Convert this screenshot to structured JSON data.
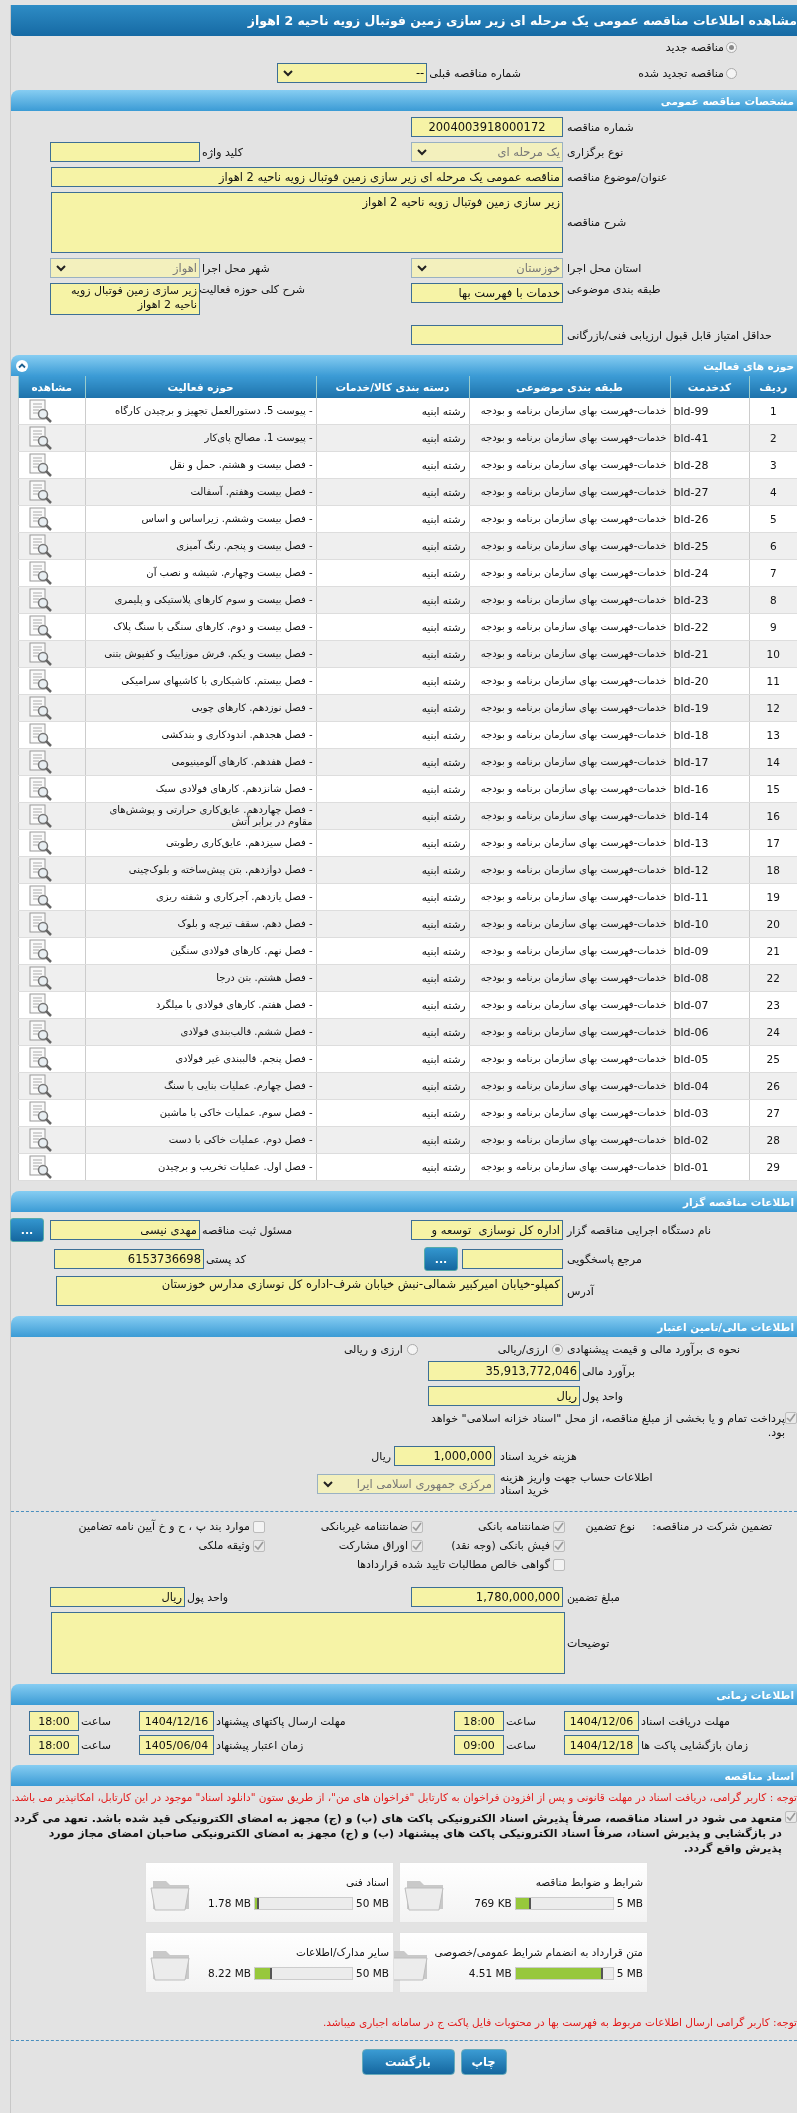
{
  "title": "مشاهده اطلاعات مناقصه عمومی یک مرحله ای زیر سازی زمین فوتبال زویه ناحیه 2 اهواز",
  "tender_kind": [
    {
      "label": "مناقصه جدید",
      "selected": true
    },
    {
      "label": "مناقصه تجدید شده",
      "selected": false
    }
  ],
  "previous_tender": {
    "label": "شماره مناقصه قبلی",
    "value": "--"
  },
  "general": {
    "header": "مشخصات مناقصه عمومی",
    "tender_number": {
      "label": "شماره مناقصه",
      "value": "2004003918000172"
    },
    "holding_type": {
      "label": "نوع برگزاری",
      "value": "یک مرحله ای",
      "disabled": true
    },
    "keyword": {
      "label": "کلید واژه"
    },
    "subject": {
      "label": "عنوان/موضوع مناقصه",
      "value": "مناقصه عمومی یک مرحله ای زیر سازی زمین فوتبال زویه ناحیه 2 اهواز"
    },
    "description": {
      "label": "شرح مناقصه",
      "value": "زیر سازی زمین فوتبال زویه ناحیه 2 اهواز"
    },
    "province": {
      "label": "استان محل اجرا",
      "value": "خوزستان",
      "disabled": true
    },
    "city": {
      "label": "شهر محل اجرا",
      "value": "اهواز",
      "disabled": true
    },
    "category": {
      "label": "طبقه بندی موضوعی",
      "value": "خدمات با فهرست بها"
    },
    "scope": {
      "label": "شرح کلی حوزه فعالیت",
      "value": "زیر سازی زمین فوتبال زویه ناحیه 2 اهواز"
    },
    "min_score": {
      "label": "حداقل امتیاز قابل قبول ارزیابی فنی/بازرگانی"
    }
  },
  "activities": {
    "header": "حوزه های فعالیت",
    "columns": [
      "ردیف",
      "کدخدمت",
      "طبقه بندی موضوعی",
      "دسته بندی کالا/خدمات",
      "حوزه فعالیت",
      "مشاهده"
    ],
    "rows": [
      {
        "row": "1",
        "code": "bld-99",
        "category": "خدمات-فهرست بهای سازمان برنامه و بودجه",
        "group": "رشته ابنیه",
        "activity": "- پیوست 5. دستورالعمل تجهیز و برچیدن کارگاه"
      },
      {
        "row": "2",
        "code": "bld-41",
        "category": "خدمات-فهرست بهای سازمان برنامه و بودجه",
        "group": "رشته ابنیه",
        "activity": "- پیوست 1. مصالح پای‌کار"
      },
      {
        "row": "3",
        "code": "bld-28",
        "category": "خدمات-فهرست بهای سازمان برنامه و بودجه",
        "group": "رشته ابنیه",
        "activity": "- فصل بیست و هشتم. حمل و نقل"
      },
      {
        "row": "4",
        "code": "bld-27",
        "category": "خدمات-فهرست بهای سازمان برنامه و بودجه",
        "group": "رشته ابنیه",
        "activity": "- فصل بیست وهفتم. آسفالت"
      },
      {
        "row": "5",
        "code": "bld-26",
        "category": "خدمات-فهرست بهای سازمان برنامه و بودجه",
        "group": "رشته ابنیه",
        "activity": "- فصل بیست وششم. زیراساس و اساس"
      },
      {
        "row": "6",
        "code": "bld-25",
        "category": "خدمات-فهرست بهای سازمان برنامه و بودجه",
        "group": "رشته ابنیه",
        "activity": "- فصل بیست و پنجم. رنگ آمیزی"
      },
      {
        "row": "7",
        "code": "bld-24",
        "category": "خدمات-فهرست بهای سازمان برنامه و بودجه",
        "group": "رشته ابنیه",
        "activity": "- فصل بیست وچهارم. شیشه و نصب آن"
      },
      {
        "row": "8",
        "code": "bld-23",
        "category": "خدمات-فهرست بهای سازمان برنامه و بودجه",
        "group": "رشته ابنیه",
        "activity": "- فصل بیست و سوم کارهای پلاستیکی و پلیمری"
      },
      {
        "row": "9",
        "code": "bld-22",
        "category": "خدمات-فهرست بهای سازمان برنامه و بودجه",
        "group": "رشته ابنیه",
        "activity": "- فصل بیست و دوم. کارهای سنگی با سنگ پلاک"
      },
      {
        "row": "10",
        "code": "bld-21",
        "category": "خدمات-فهرست بهای سازمان برنامه و بودجه",
        "group": "رشته ابنیه",
        "activity": "- فصل بیست و یکم. فرش موزاییک و کفپوش بتنی"
      },
      {
        "row": "11",
        "code": "bld-20",
        "category": "خدمات-فهرست بهای سازمان برنامه و بودجه",
        "group": "رشته ابنیه",
        "activity": "- فصل بیستم. کاشیکاری با کاشیهای سرامیکی"
      },
      {
        "row": "12",
        "code": "bld-19",
        "category": "خدمات-فهرست بهای سازمان برنامه و بودجه",
        "group": "رشته ابنیه",
        "activity": "- فصل نوزدهم. کارهای چوبی"
      },
      {
        "row": "13",
        "code": "bld-18",
        "category": "خدمات-فهرست بهای سازمان برنامه و بودجه",
        "group": "رشته ابنیه",
        "activity": "- فصل هجدهم. اندودکاری و بندکشی"
      },
      {
        "row": "14",
        "code": "bld-17",
        "category": "خدمات-فهرست بهای سازمان برنامه و بودجه",
        "group": "رشته ابنیه",
        "activity": "- فصل هفدهم. کارهای آلومینیومی"
      },
      {
        "row": "15",
        "code": "bld-16",
        "category": "خدمات-فهرست بهای سازمان برنامه و بودجه",
        "group": "رشته ابنیه",
        "activity": "- فصل شانزدهم. کارهای فولادی سبک"
      },
      {
        "row": "16",
        "code": "bld-14",
        "category": "خدمات-فهرست بهای سازمان برنامه و بودجه",
        "group": "رشته ابنیه",
        "activity": "- فصل چهاردهم. عایق‌کاری حرارتی و پوشش‌های مقاوم در برابر آتش"
      },
      {
        "row": "17",
        "code": "bld-13",
        "category": "خدمات-فهرست بهای سازمان برنامه و بودجه",
        "group": "رشته ابنیه",
        "activity": "- فصل سیزدهم. عایق‌کاری رطوبتی"
      },
      {
        "row": "18",
        "code": "bld-12",
        "category": "خدمات-فهرست بهای سازمان برنامه و بودجه",
        "group": "رشته ابنیه",
        "activity": "- فصل دوازدهم. بتن پیش‌ساخته و بلوک‌چینی"
      },
      {
        "row": "19",
        "code": "bld-11",
        "category": "خدمات-فهرست بهای سازمان برنامه و بودجه",
        "group": "رشته ابنیه",
        "activity": "- فصل یازدهم. آجرکاری و شفته ریزی"
      },
      {
        "row": "20",
        "code": "bld-10",
        "category": "خدمات-فهرست بهای سازمان برنامه و بودجه",
        "group": "رشته ابنیه",
        "activity": "- فصل دهم. سقف تیرچه و بلوک"
      },
      {
        "row": "21",
        "code": "bld-09",
        "category": "خدمات-فهرست بهای سازمان برنامه و بودجه",
        "group": "رشته ابنیه",
        "activity": "- فصل نهم. کارهای فولادی سنگین"
      },
      {
        "row": "22",
        "code": "bld-08",
        "category": "خدمات-فهرست بهای سازمان برنامه و بودجه",
        "group": "رشته ابنیه",
        "activity": "- فصل هشتم. بتن درجا"
      },
      {
        "row": "23",
        "code": "bld-07",
        "category": "خدمات-فهرست بهای سازمان برنامه و بودجه",
        "group": "رشته ابنیه",
        "activity": "- فصل هفتم. کارهای فولادی با میلگرد"
      },
      {
        "row": "24",
        "code": "bld-06",
        "category": "خدمات-فهرست بهای سازمان برنامه و بودجه",
        "group": "رشته ابنیه",
        "activity": "- فصل ششم. قالب‌بندی فولادی"
      },
      {
        "row": "25",
        "code": "bld-05",
        "category": "خدمات-فهرست بهای سازمان برنامه و بودجه",
        "group": "رشته ابنیه",
        "activity": "- فصل پنجم. قالببندی غیر فولادی"
      },
      {
        "row": "26",
        "code": "bld-04",
        "category": "خدمات-فهرست بهای سازمان برنامه و بودجه",
        "group": "رشته ابنیه",
        "activity": "- فصل چهارم. عملیات بنایی با سنگ"
      },
      {
        "row": "27",
        "code": "bld-03",
        "category": "خدمات-فهرست بهای سازمان برنامه و بودجه",
        "group": "رشته ابنیه",
        "activity": "- فصل سوم. عملیات خاکی با ماشین"
      },
      {
        "row": "28",
        "code": "bld-02",
        "category": "خدمات-فهرست بهای سازمان برنامه و بودجه",
        "group": "رشته ابنیه",
        "activity": "- فصل دوم. عملیات خاکی با دست"
      },
      {
        "row": "29",
        "code": "bld-01",
        "category": "خدمات-فهرست بهای سازمان برنامه و بودجه",
        "group": "رشته ابنیه",
        "activity": "- فصل اول. عملیات تخریب و برچیدن"
      }
    ]
  },
  "organizer": {
    "header": "اطلاعات مناقصه گزار",
    "agency": {
      "label": "نام دستگاه اجرایی مناقصه گزار",
      "value": "اداره کل نوسازی  توسعه و"
    },
    "registrar": {
      "label": "مسئول ثبت مناقصه",
      "value": "مهدی نیسی",
      "button": "..."
    },
    "reference": {
      "label": "مرجع پاسخگویی",
      "button": "..."
    },
    "postal_code": {
      "label": "کد پستی",
      "value": "6153736698"
    },
    "address": {
      "label": "آدرس",
      "value": "کمپلو-خیابان امیرکبیر شمالی-نبش خیابان شرف-اداره کل نوسازی مدارس خوزستان"
    }
  },
  "finance": {
    "header": "اطلاعات مالی/تامین اعتبار",
    "method": {
      "label": "نحوه ی برآورد مالی و قیمت پیشنهادی",
      "options": [
        {
          "label": "ارزی/ریالی",
          "selected": true
        },
        {
          "label": "ارزی و ریالی",
          "selected": false
        }
      ]
    },
    "estimate": {
      "label": "برآورد مالی",
      "value": "35,913,772,046"
    },
    "currency": {
      "label": "واحد پول",
      "value": "ریال"
    },
    "treasury": {
      "label": "پرداخت تمام و یا بخشی از مبلغ مناقصه، از محل \"اسناد خزانه اسلامی\" خواهد بود.",
      "checked": true
    },
    "doc_fee": {
      "label": "هزینه خرید اسناد",
      "value": "1,000,000",
      "unit": "ریال"
    },
    "account": {
      "label": "اطلاعات حساب جهت واریز هزینه خرید اسناد",
      "value": "مرکزی جمهوری اسلامی ایرا",
      "disabled": true
    }
  },
  "guarantee": {
    "label": "تضمین شرکت در مناقصه:",
    "type_label": "نوع تضمین",
    "options": [
      {
        "label": "ضمانتنامه بانکی",
        "checked": true
      },
      {
        "label": "ضمانتنامه غیربانکی",
        "checked": true
      },
      {
        "label": "موارد بند پ ، ح و خ آیین نامه تضامین",
        "checked": false
      },
      {
        "label": "فیش بانکی (وجه نقد)",
        "checked": true
      },
      {
        "label": "اوراق مشارکت",
        "checked": true
      },
      {
        "label": "وثیقه ملکی",
        "checked": true
      },
      {
        "label": "گواهی خالص مطالبات تایید شده قراردادها",
        "checked": false
      }
    ],
    "amount": {
      "label": "مبلغ تضمین",
      "value": "1,780,000,000"
    },
    "currency": {
      "label": "واحد پول",
      "value": "ریال"
    },
    "notes": {
      "label": "توضیحات"
    }
  },
  "timing": {
    "header": "اطلاعات زمانی",
    "items": [
      {
        "label": "مهلت دریافت اسناد",
        "date": "1404/12/06",
        "time_label": "ساعت",
        "time": "18:00"
      },
      {
        "label": "مهلت ارسال پاکتهای پیشنهاد",
        "date": "1404/12/16",
        "time_label": "ساعت",
        "time": "18:00"
      },
      {
        "label": "زمان بازگشایی پاکت ها",
        "date": "1404/12/18",
        "time_label": "ساعت",
        "time": "09:00"
      },
      {
        "label": "زمان اعتبار پیشنهاد",
        "date": "1405/06/04",
        "time_label": "ساعت",
        "time": "18:00"
      }
    ]
  },
  "documents": {
    "header": "اسناد مناقصه",
    "note": "توجه : کاربر گرامی، دریافت اسناد در مهلت قانونی و پس از افزودن فراخوان به کارتابل \"فراخوان های من\"، از طریق ستون \"دانلود اسناد\" موجود در این کارتابل، امکانپذیر می باشد.",
    "commitment": {
      "text": "متعهد می شود در اسناد مناقصه، صرفاً پذیرش اسناد الکترونیکی پاکت های (ب) و (ج) مجهز به امضای الکترونیکی قید شده باشد. تعهد می گردد در بازگشایی و پذیرش اسناد، صرفاً اسناد الکترونیکی پاکت های پیشنهاد (ب) و (ج) مجهز به امضای الکترونیکی صاحبان امضای مجاز مورد پذیرش واقع گردد.",
      "checked": true
    },
    "files": [
      {
        "name": "شرایط و ضوابط مناقصه",
        "size": "769 KB",
        "max": "5 MB",
        "level": 0.16
      },
      {
        "name": "اسناد فنی",
        "size": "1.78 MB",
        "max": "50 MB",
        "level": 0.04
      },
      {
        "name": "متن قرارداد به انضمام شرایط عمومی/خصوصی",
        "size": "4.51 MB",
        "max": "5 MB",
        "level": 0.9
      },
      {
        "name": "سایر مدارک/اطلاعات",
        "size": "8.22 MB",
        "max": "50 MB",
        "level": 0.17
      }
    ],
    "footer_note": "توجه: کاربر گرامی ارسال اطلاعات مربوط به فهرست بها در محتویات فایل پاکت ج در سامانه اجباری میباشد."
  },
  "buttons": [
    "چاپ",
    "بازگشت"
  ]
}
